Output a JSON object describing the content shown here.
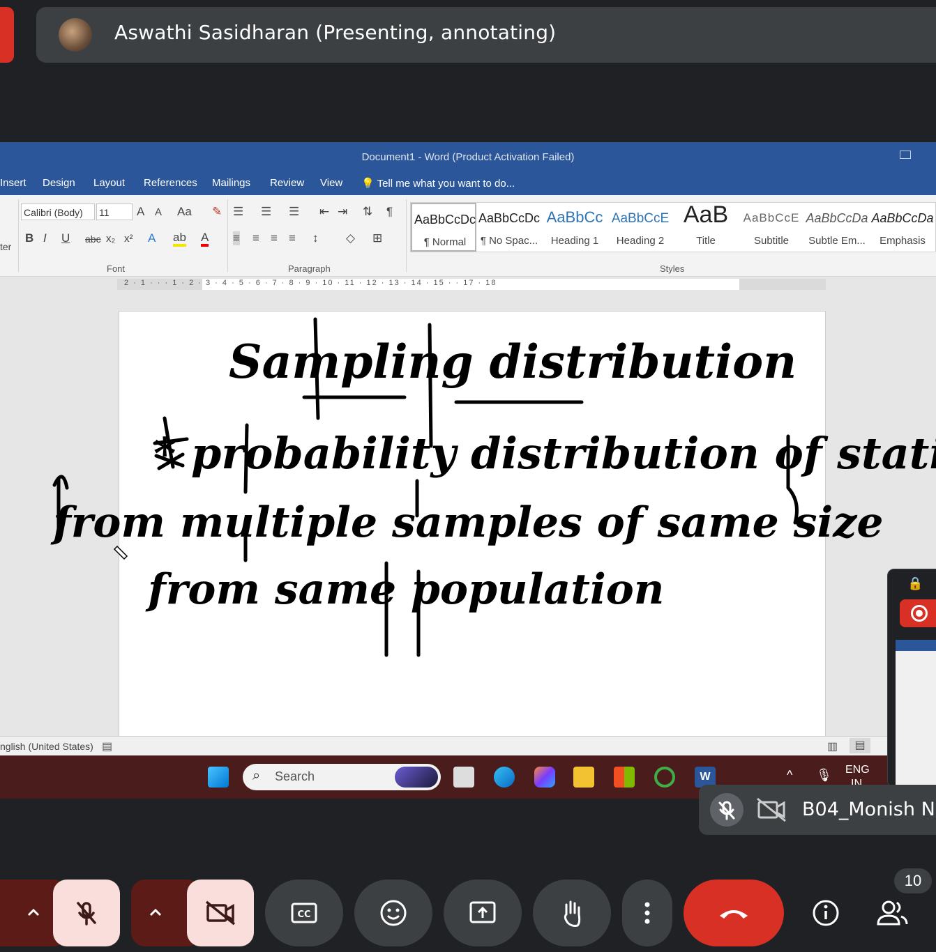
{
  "meet": {
    "presenter_banner": "Aswathi Sasidharan (Presenting, annotating)",
    "participant_tile_name": "B04_Monish N",
    "participant_count": "10"
  },
  "word": {
    "title": "Document1 - Word (Product Activation Failed)",
    "menu": [
      "Insert",
      "Design",
      "Layout",
      "References",
      "Mailings",
      "Review",
      "View"
    ],
    "tell_me": "Tell me what you want to do...",
    "font_name": "Calibri (Body)",
    "font_size": "11",
    "group_font": "Font",
    "group_paragraph": "Paragraph",
    "group_styles": "Styles",
    "left_cut_label": "ter",
    "styles": [
      {
        "sample": "AaBbCcDc",
        "name": "¶ Normal"
      },
      {
        "sample": "AaBbCcDc",
        "name": "¶ No Spac..."
      },
      {
        "sample": "AaBbCc",
        "name": "Heading 1"
      },
      {
        "sample": "AaBbCcE",
        "name": "Heading 2"
      },
      {
        "sample": "AaB",
        "name": "Title"
      },
      {
        "sample": "AaBbCcE",
        "name": "Subtitle"
      },
      {
        "sample": "AaBbCcDa",
        "name": "Subtle Em..."
      },
      {
        "sample": "AaBbCcDa",
        "name": "Emphasis"
      }
    ],
    "ruler_marks": "2 · 1 · · · 1 · 2 · 3 · 4 · 5 · 6 · 7 · 8 · 9 · 10 · 11 · 12 · 13 · 14 · 15 · · 17 · 18",
    "status_language": "nglish (United States)"
  },
  "annotation": {
    "lines": [
      "Sampling distribution",
      "* probability distribution of statistic",
      "from multiple samples of same size",
      "from same population"
    ]
  },
  "taskbar": {
    "search_placeholder": "Search",
    "lang_line1": "ENG",
    "lang_line2": "IN"
  },
  "colors": {
    "meet_bg": "#202124",
    "word_blue": "#2b579a",
    "end_call": "#d93025"
  }
}
